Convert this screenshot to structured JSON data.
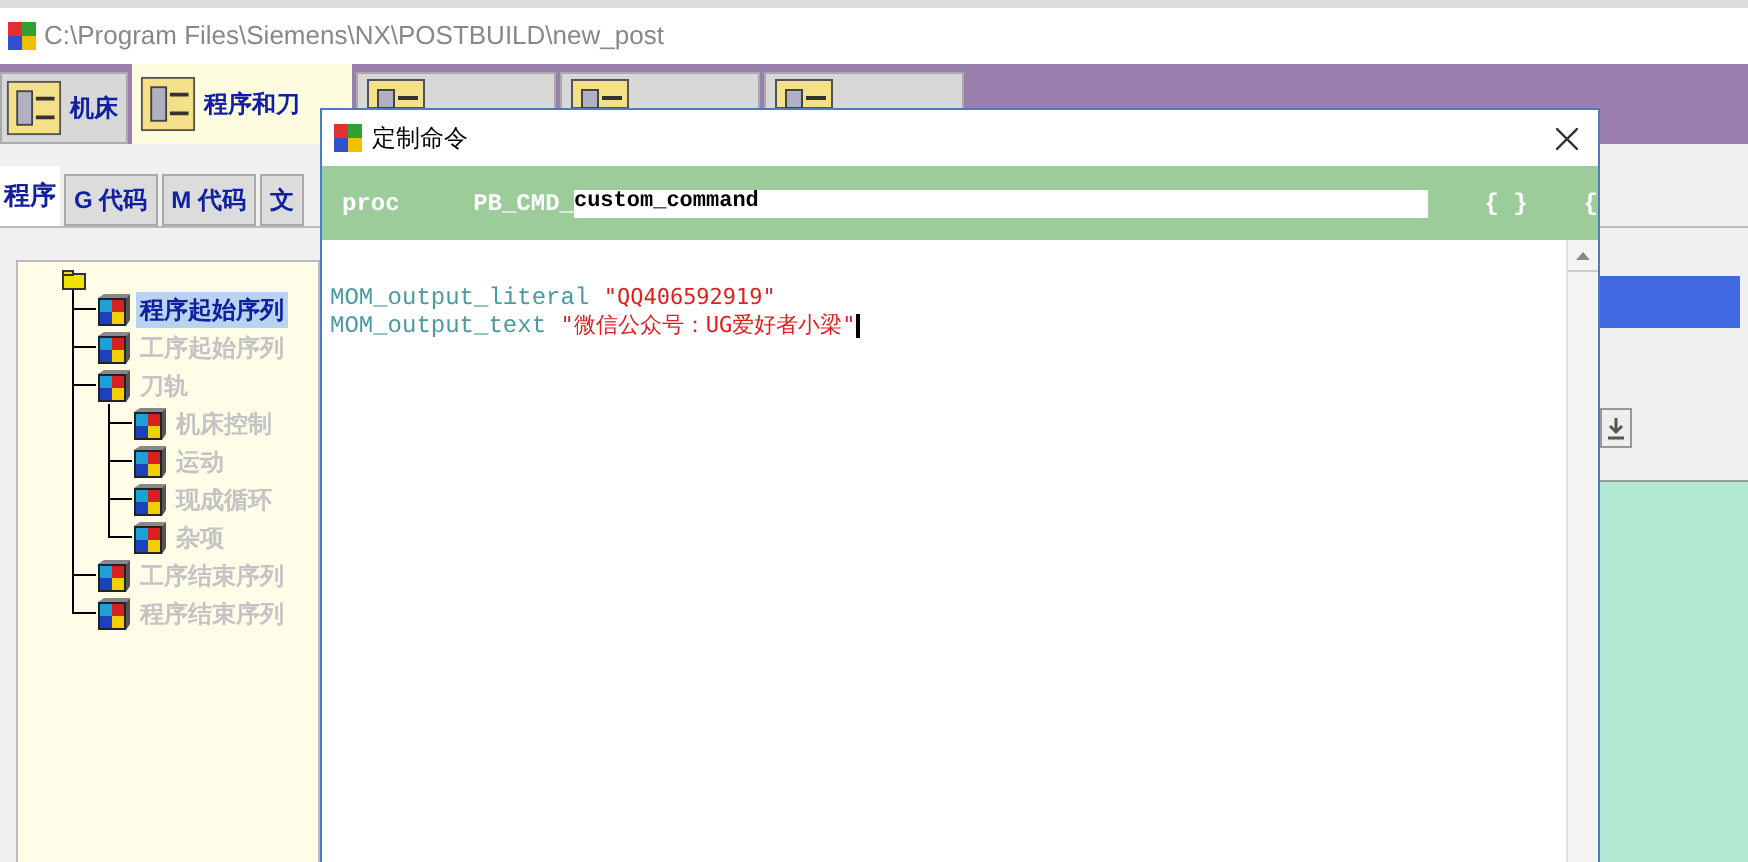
{
  "window": {
    "title": "C:\\Program Files\\Siemens\\NX\\POSTBUILD\\new_post"
  },
  "main_tabs": [
    {
      "label": "机床",
      "selected": false
    },
    {
      "label": "程序和刀",
      "selected": true
    },
    {
      "selected": false
    },
    {
      "selected": false
    },
    {
      "selected": false
    }
  ],
  "sub_tabs": [
    {
      "label": "程序",
      "selected": true
    },
    {
      "label": "G 代码",
      "selected": false
    },
    {
      "label": "M 代码",
      "selected": false
    },
    {
      "label": "文",
      "selected": false
    }
  ],
  "tree": {
    "children": [
      {
        "label": "程序起始序列",
        "selected": true
      },
      {
        "label": "工序起始序列",
        "selected": false
      },
      {
        "label": "刀轨",
        "selected": false,
        "children": [
          {
            "label": "机床控制",
            "selected": false
          },
          {
            "label": "运动",
            "selected": false
          },
          {
            "label": "现成循环",
            "selected": false
          },
          {
            "label": "杂项",
            "selected": false
          }
        ]
      },
      {
        "label": "工序结束序列",
        "selected": false
      },
      {
        "label": "程序结束序列",
        "selected": false
      }
    ]
  },
  "dialog": {
    "title": "定制命令",
    "proc": "proc",
    "prefix": "PB_CMD_",
    "name": "custom_command",
    "braces": "{ }",
    "brace_cut": "{",
    "lines": [
      {
        "command": "MOM_output_literal",
        "argument": "\"QQ406592919\""
      },
      {
        "command": "MOM_output_text",
        "argument": "\"微信公众号：UG爱好者小梁\""
      }
    ]
  }
}
